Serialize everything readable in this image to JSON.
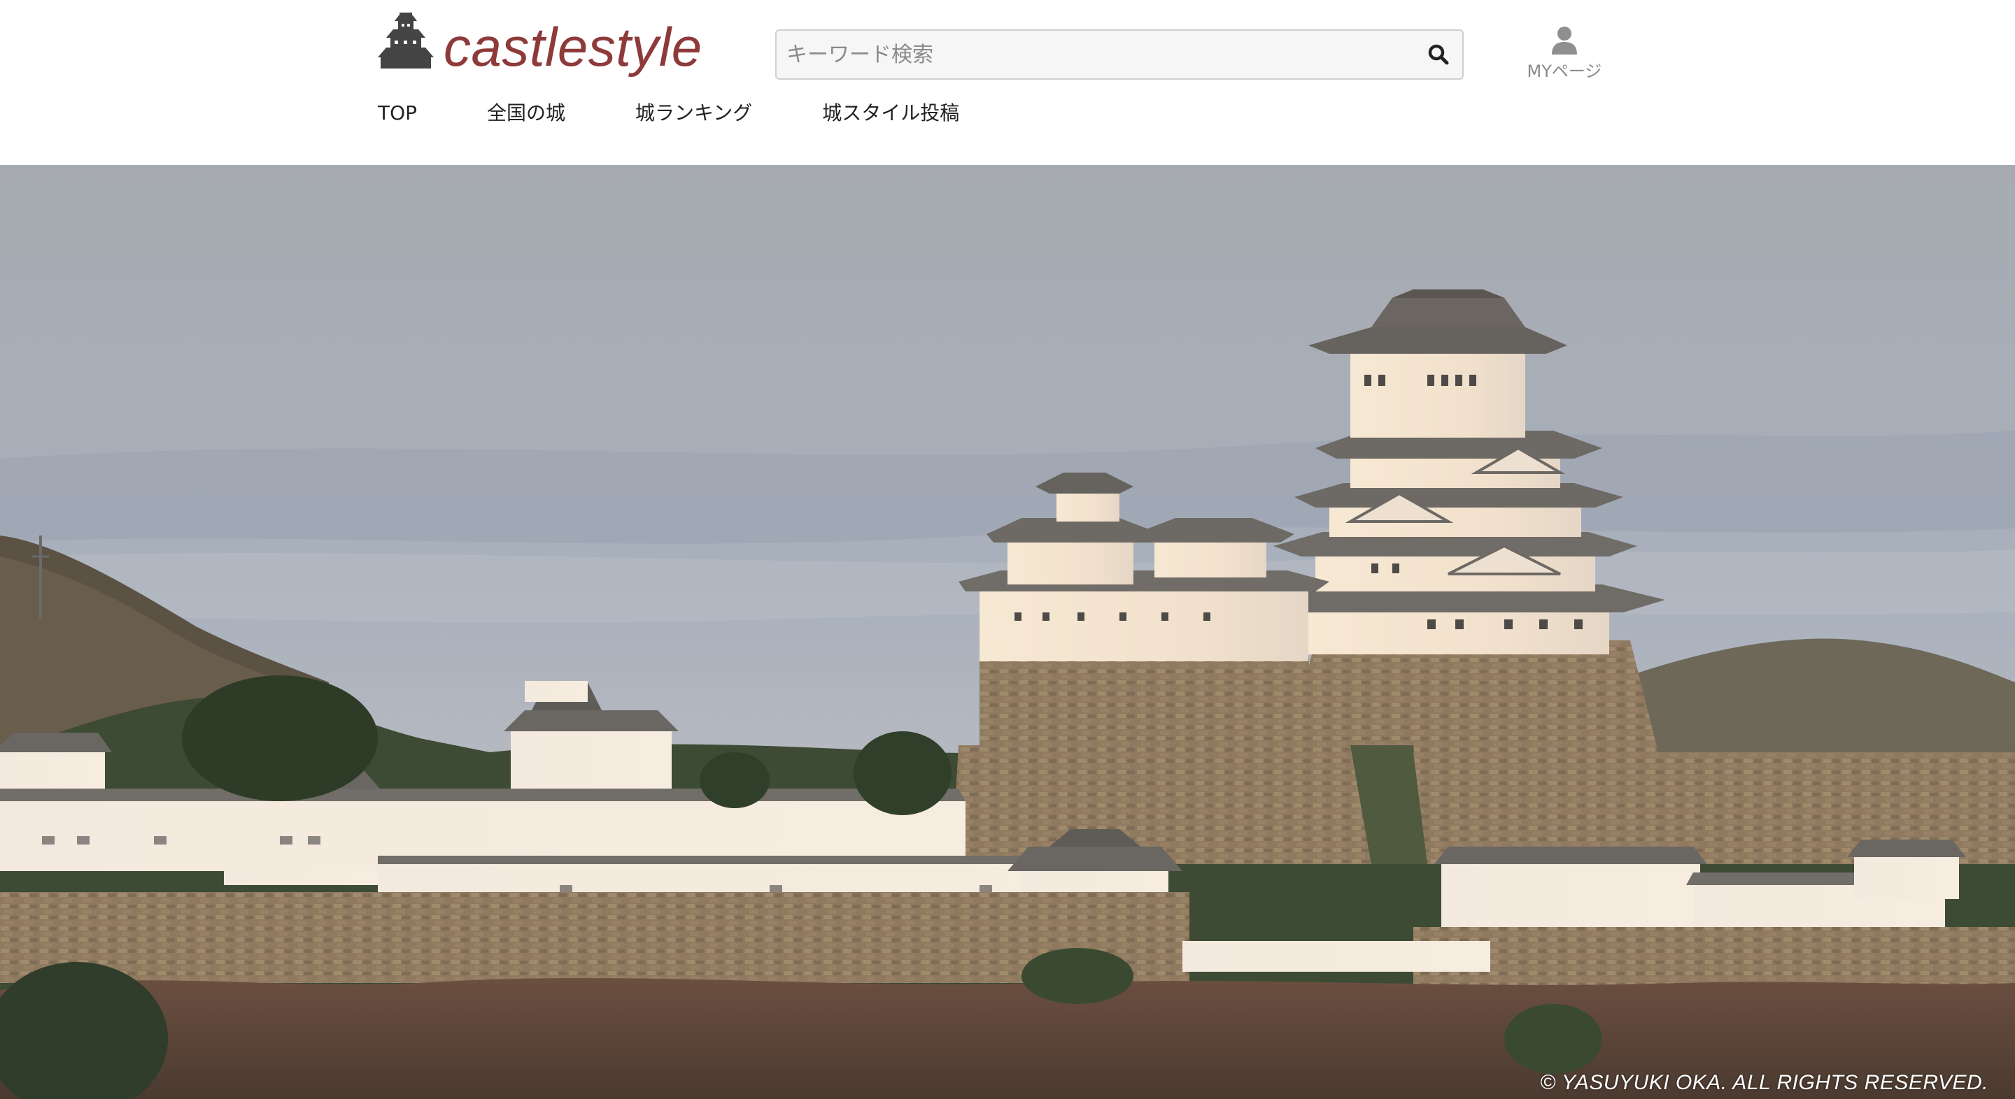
{
  "brand": {
    "name": "castlestyle",
    "logo_icon": "castle-icon",
    "brand_color": "#8e3a3a"
  },
  "search": {
    "placeholder": "キーワード検索",
    "value": "",
    "icon": "search-icon"
  },
  "account": {
    "label": "MYページ",
    "icon": "user-icon"
  },
  "nav": {
    "items": [
      {
        "label": "TOP"
      },
      {
        "label": "全国の城"
      },
      {
        "label": "城ランキング"
      },
      {
        "label": "城スタイル投稿"
      }
    ]
  },
  "hero": {
    "copyright": "© YASUYUKI OKA. ALL RIGHTS RESERVED."
  },
  "colors": {
    "text": "#222222",
    "muted": "#8a8a8a",
    "sky_top": "#a9aeb5",
    "castle_wall": "#f1e6da",
    "roof": "#6e6a66",
    "stone": "#8d7a62"
  }
}
